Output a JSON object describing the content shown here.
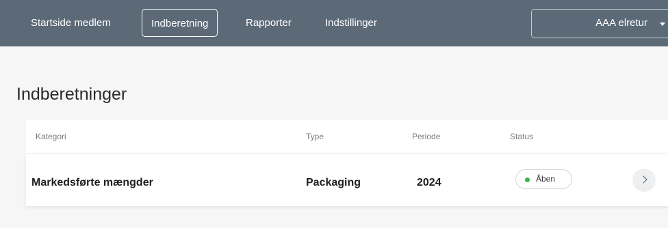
{
  "nav": {
    "items": [
      {
        "label": "Startside medlem"
      },
      {
        "label": "Indberetning"
      },
      {
        "label": "Rapporter"
      },
      {
        "label": "Indstillinger"
      }
    ],
    "active_index": 1,
    "account": {
      "label": "AAA elretur",
      "icon": "caret-down-icon"
    }
  },
  "page": {
    "title": "Indberetninger"
  },
  "table": {
    "headers": {
      "kategori": "Kategori",
      "type": "Type",
      "periode": "Periode",
      "status": "Status"
    },
    "rows": [
      {
        "kategori": "Markedsførte mængder",
        "type": "Packaging",
        "periode": "2024",
        "status": "Åben",
        "status_color": "#3bb54a",
        "action_icon": "chevron-right-icon"
      }
    ]
  },
  "colors": {
    "navbar": "#5c6a78",
    "background": "#f6f6f6",
    "status_open": "#3bb54a"
  }
}
